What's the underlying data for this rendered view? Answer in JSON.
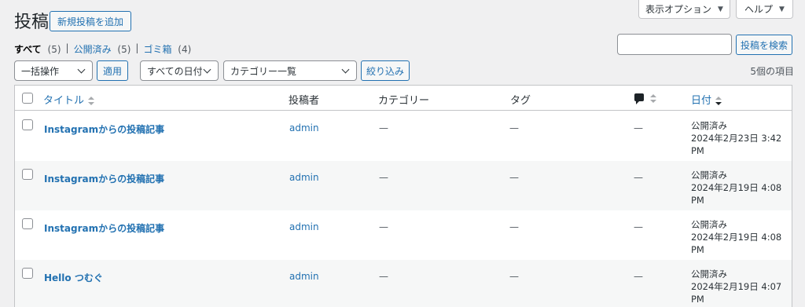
{
  "screen_options": {
    "label": "表示オプション",
    "caret": "▼"
  },
  "help": {
    "label": "ヘルプ",
    "caret": "▼"
  },
  "page_title": "投稿",
  "add_new_label": "新規投稿を追加",
  "views": [
    {
      "label": "すべて",
      "count": "(5)",
      "current": true
    },
    {
      "label": "公開済み",
      "count": "(5)",
      "current": false
    },
    {
      "label": "ゴミ箱",
      "count": "(4)",
      "current": false
    }
  ],
  "views_separator": "|",
  "search": {
    "value": "",
    "button_label": "投稿を検索"
  },
  "bulk_actions": {
    "selected": "一括操作",
    "apply_label": "適用"
  },
  "filters": {
    "date_selected": "すべての日付",
    "category_selected": "カテゴリー一覧",
    "filter_label": "絞り込み"
  },
  "item_count": "5個の項目",
  "columns": {
    "title": "タイトル",
    "author": "投稿者",
    "categories": "カテゴリー",
    "tags": "タグ",
    "date": "日付"
  },
  "rows": [
    {
      "title": "Instagramからの投稿記事",
      "author": "admin",
      "categories": "—",
      "tags": "—",
      "comments": "—",
      "status": "公開済み",
      "date": "2024年2月23日 3:42",
      "ampm": "PM"
    },
    {
      "title": "Instagramからの投稿記事",
      "author": "admin",
      "categories": "—",
      "tags": "—",
      "comments": "—",
      "status": "公開済み",
      "date": "2024年2月19日 4:08",
      "ampm": "PM"
    },
    {
      "title": "Instagramからの投稿記事",
      "author": "admin",
      "categories": "—",
      "tags": "—",
      "comments": "—",
      "status": "公開済み",
      "date": "2024年2月19日 4:08",
      "ampm": "PM"
    },
    {
      "title": "Hello つむぐ",
      "author": "admin",
      "categories": "—",
      "tags": "—",
      "comments": "—",
      "status": "公開済み",
      "date": "2024年2月19日 4:07",
      "ampm": "PM"
    }
  ],
  "colors": {
    "link": "#2271b1",
    "background": "#f0f0f1",
    "border": "#c3c4c7",
    "text": "#1d2327"
  }
}
